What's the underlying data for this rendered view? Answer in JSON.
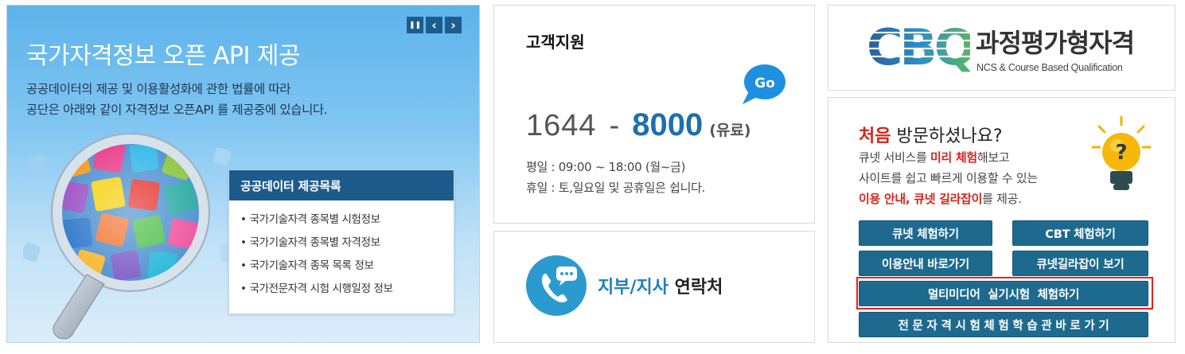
{
  "banner": {
    "controls": {
      "pause": "❚❚",
      "prev": "‹",
      "next": "›"
    },
    "title": "국가자격정보 오픈 API 제공",
    "desc_line1": "공공데이터의 제공 및 이용활성화에 관한 법률에 따라",
    "desc_line2": "공단은 아래와 같이 자격정보 오픈API 를 제공중에 있습니다.",
    "box_title": "공공데이터 제공목록",
    "items": [
      "국가기술자격 종목별 시험정보",
      "국가기술자격 종목별 자격정보",
      "국가기술자격 종목 목록 정보",
      "국가전문자격 시험 시행일정 정보"
    ]
  },
  "support": {
    "title": "고객지원",
    "go_label": "Go",
    "phone_prefix": "1644",
    "phone_dash": "-",
    "phone_number": "8000",
    "phone_note": "(유료)",
    "hours_weekday": "평일 : 09:00 ~ 18:00 (월~금)",
    "hours_weekend": "휴일 : 토,일요일 및 공휴일은 쉽니다."
  },
  "branch": {
    "label_accent": "지부/지사",
    "label_rest": " 연락처"
  },
  "cbq": {
    "logo_text": "CBQ",
    "title_kr": "과정평가형자격",
    "title_en": "NCS & Course Based Qualification"
  },
  "first_visit": {
    "q_red": "처음",
    "q_rest": " 방문하셨나요?",
    "line1_a": "큐넷 서비스를 ",
    "line1_red": "미리 체험",
    "line1_b": "해보고",
    "line2": "사이트를 쉽고 빠르게 이용할 수 있는",
    "line3_red": "이용 안내, 큐넷 길라잡이",
    "line3_b": "를 제공.",
    "bulb_symbol": "?",
    "buttons": {
      "qnet_trial": "큐넷 체험하기",
      "cbt_trial": "CBT 체험하기",
      "guide": "이용안내 바로가기",
      "qnet_guide": "큐넷길라잡이 보기",
      "multimedia": "멀티미디어  실기시험  체험하기",
      "professional": "전 문 자 격 시 험 체 험 학 습 관 바 로 가 기"
    }
  },
  "colors": {
    "button_bg": "#1e6a8f",
    "accent_blue": "#1e6fae",
    "accent_red": "#d8241c",
    "banner_dark": "#1d5b8c",
    "highlight": "#e4211e"
  }
}
